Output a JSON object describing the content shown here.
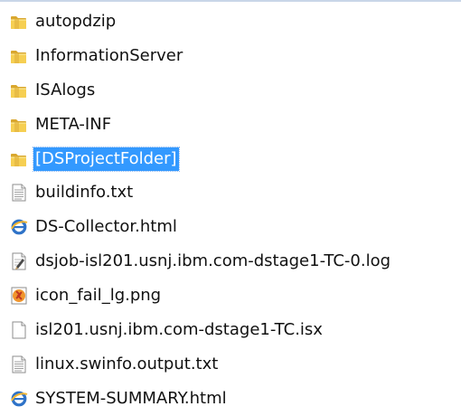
{
  "colors": {
    "selection_bg": "#3399ff",
    "selection_text": "#ffffff",
    "text": "#111111"
  },
  "files": [
    {
      "label": "autopdzip",
      "icon": "folder-icon",
      "selected": false
    },
    {
      "label": "InformationServer",
      "icon": "folder-icon",
      "selected": false
    },
    {
      "label": "ISAlogs",
      "icon": "folder-icon",
      "selected": false
    },
    {
      "label": "META-INF",
      "icon": "folder-icon",
      "selected": false
    },
    {
      "label": "[DSProjectFolder]",
      "icon": "folder-icon",
      "selected": true
    },
    {
      "label": "buildinfo.txt",
      "icon": "text-file-icon",
      "selected": false
    },
    {
      "label": "DS-Collector.html",
      "icon": "html-file-icon",
      "selected": false
    },
    {
      "label": "dsjob-isl201.usnj.ibm.com-dstage1-TC-0.log",
      "icon": "log-file-icon",
      "selected": false
    },
    {
      "label": "icon_fail_lg.png",
      "icon": "image-file-icon",
      "selected": false
    },
    {
      "label": "isl201.usnj.ibm.com-dstage1-TC.isx",
      "icon": "generic-file-icon",
      "selected": false
    },
    {
      "label": "linux.swinfo.output.txt",
      "icon": "text-file-icon",
      "selected": false
    },
    {
      "label": "SYSTEM-SUMMARY.html",
      "icon": "html-file-icon",
      "selected": false
    }
  ]
}
